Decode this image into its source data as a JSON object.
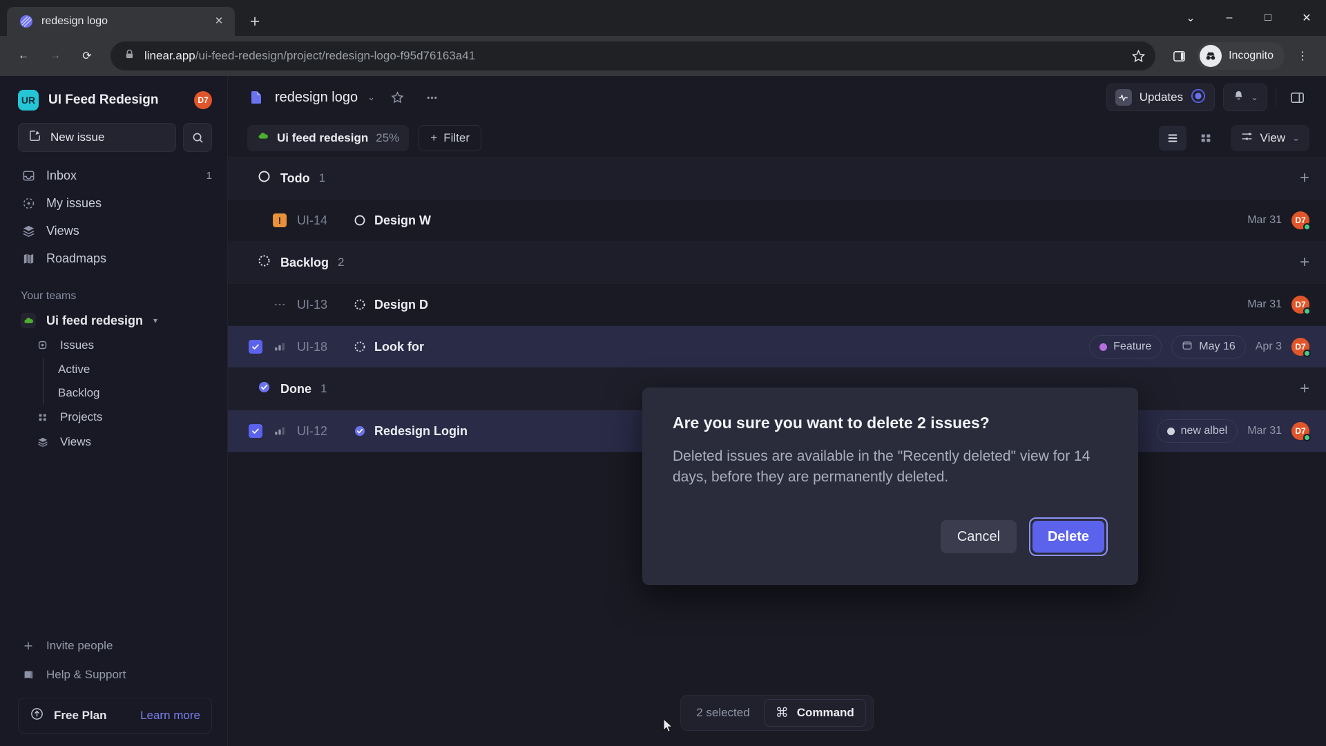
{
  "browser": {
    "tab": {
      "title": "redesign logo",
      "favicon": "linear-logo-icon",
      "close": "×"
    },
    "new_tab": "+",
    "window_controls": {
      "minimize": "⌄",
      "restore": "–",
      "maximize": "□",
      "close": "✕"
    },
    "nav": {
      "back": "←",
      "forward": "→",
      "reload": "⟳"
    },
    "omnibox": {
      "lock": "lock-icon",
      "domain": "linear.app",
      "path": "/ui-feed-redesign/project/redesign-logo-f95d76163a41",
      "star": "☆"
    },
    "profile": {
      "label": "Incognito",
      "menu": "⋮",
      "panel_icon": "side-panel-icon"
    }
  },
  "sidebar": {
    "workspace": {
      "initials": "UR",
      "name": "UI Feed Redesign",
      "badge": "D7"
    },
    "new_issue": {
      "label": "New issue",
      "icon": "pencil-square-icon"
    },
    "search_icon": "search-icon",
    "nav": [
      {
        "label": "Inbox",
        "icon": "inbox-icon",
        "count": "1"
      },
      {
        "label": "My issues",
        "icon": "target-icon",
        "count": ""
      },
      {
        "label": "Views",
        "icon": "layers-icon",
        "count": ""
      },
      {
        "label": "Roadmaps",
        "icon": "map-icon",
        "count": ""
      }
    ],
    "teams_heading": "Your teams",
    "team": {
      "name": "Ui feed redesign",
      "icon": "cloud-icon",
      "caret": "▾"
    },
    "team_children": [
      {
        "label": "Issues",
        "icon": "issues-icon",
        "type": "item"
      },
      {
        "label": "Active",
        "icon": "",
        "type": "leaf"
      },
      {
        "label": "Backlog",
        "icon": "",
        "type": "leaf"
      },
      {
        "label": "Projects",
        "icon": "grid-icon",
        "type": "item"
      },
      {
        "label": "Views",
        "icon": "layers-icon",
        "type": "item"
      }
    ],
    "footer": [
      {
        "label": "Invite people",
        "icon": "plus-icon"
      },
      {
        "label": "Help & Support",
        "icon": "book-icon"
      }
    ],
    "plan": {
      "icon": "upgrade-arrow-icon",
      "name": "Free Plan",
      "link": "Learn more"
    }
  },
  "header": {
    "project_icon": "project-page-icon",
    "project_name": "redesign logo",
    "caret": "⌄",
    "favorite_icon": "star-icon",
    "more_icon": "more-horizontal-icon",
    "updates": {
      "label": "Updates",
      "icon": "activity-icon",
      "status_icon": "target-ring-icon"
    },
    "notifications": {
      "icon": "bell-icon",
      "caret": "⌄"
    },
    "sidebar_toggle": "panel-right-icon"
  },
  "filterbar": {
    "team_chip": {
      "icon": "cloud-icon",
      "name": "Ui feed redesign",
      "progress": "25%"
    },
    "filter": {
      "plus": "+",
      "label": "Filter"
    },
    "list_view_icon": "list-view-icon",
    "board_view_icon": "board-view-icon",
    "view": {
      "icon": "sliders-icon",
      "label": "View",
      "caret": "⌄"
    }
  },
  "issue_groups": [
    {
      "name": "Todo",
      "count": "1",
      "state_icon": "todo-circle-icon",
      "add": "+",
      "issues": [
        {
          "selected": false,
          "priority": "urgent",
          "priority_glyph": "!",
          "key": "UI-14",
          "state_icon": "todo-circle-icon",
          "title": "Design W",
          "tags": [],
          "due": "",
          "date": "Mar 31",
          "avatar": "D7"
        }
      ]
    },
    {
      "name": "Backlog",
      "count": "2",
      "state_icon": "backlog-dashed-icon",
      "add": "+",
      "issues": [
        {
          "selected": false,
          "priority": "none",
          "priority_glyph": "···",
          "key": "UI-13",
          "state_icon": "backlog-dashed-icon",
          "title": "Design D",
          "tags": [],
          "due": "",
          "date": "Mar 31",
          "avatar": "D7"
        },
        {
          "selected": true,
          "priority": "medium",
          "priority_glyph": "bars",
          "key": "UI-18",
          "state_icon": "backlog-dashed-icon",
          "title": "Look for",
          "tags": [
            {
              "label": "Feature",
              "color": "#b46ee0"
            }
          ],
          "due": "May 16",
          "date": "Apr 3",
          "avatar": "D7"
        }
      ]
    },
    {
      "name": "Done",
      "count": "1",
      "state_icon": "done-check-icon",
      "add": "+",
      "issues": [
        {
          "selected": true,
          "priority": "medium",
          "priority_glyph": "bars",
          "key": "UI-12",
          "state_icon": "done-check-icon",
          "title": "Redesign Login",
          "tags": [
            {
              "label": "new albel",
              "color": "#d3d6de"
            }
          ],
          "due": "",
          "date": "Mar 31",
          "avatar": "D7"
        }
      ]
    }
  ],
  "selection_bar": {
    "count_label": "2 selected",
    "command": {
      "glyph": "⌘",
      "label": "Command"
    }
  },
  "modal": {
    "title": "Are you sure you want to delete 2 issues?",
    "body": "Deleted issues are available in the \"Recently deleted\" view for 14 days, before they are permanently deleted.",
    "cancel": "Cancel",
    "confirm": "Delete"
  },
  "colors": {
    "accent": "#5b62ec",
    "avatar": "#e0562a",
    "online": "#49c98a",
    "urgent": "#e8913b",
    "team": "#4caf2f"
  }
}
